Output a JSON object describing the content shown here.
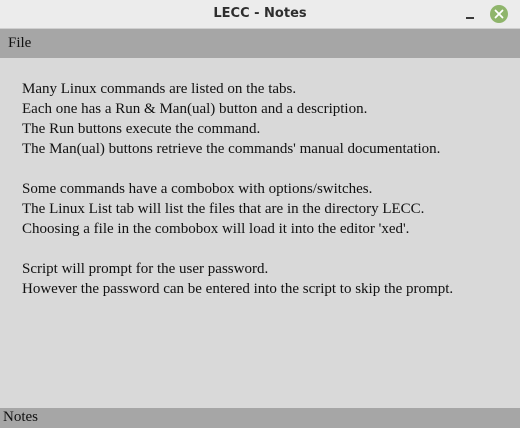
{
  "window": {
    "title": "LECC - Notes"
  },
  "menu": {
    "file_label": "File"
  },
  "content": {
    "paragraph1": [
      "Many Linux commands are listed on the tabs.",
      "Each one has a Run & Man(ual) button and a description.",
      "The Run buttons execute the command.",
      "The Man(ual) buttons retrieve the commands' manual documentation."
    ],
    "paragraph2": [
      "Some commands have a combobox with options/switches.",
      "The Linux List tab will list the files that are in the directory LECC.",
      "Choosing a file in the combobox will load it into the editor 'xed'."
    ],
    "paragraph3": [
      "Script will prompt for the user password.",
      "However the password can be entered into the script to skip the prompt."
    ]
  },
  "statusbar": {
    "text": "Notes"
  },
  "icons": {
    "minimize": "minimize-icon",
    "close": "close-icon"
  },
  "colors": {
    "close_button": "#8fb56b",
    "menubar": "#a6a6a6",
    "background": "#d9d9d9"
  }
}
